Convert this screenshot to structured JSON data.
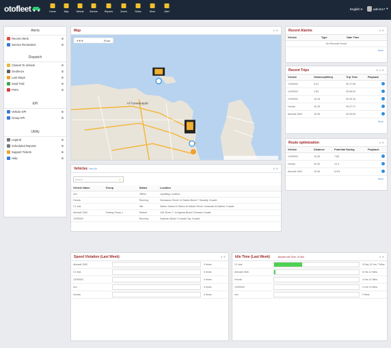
{
  "app": {
    "logo": "otofleet",
    "lang": "English",
    "user": "admin17"
  },
  "nav": [
    {
      "label": "Home",
      "icon": "home-icon"
    },
    {
      "label": "Map",
      "icon": "map-icon"
    },
    {
      "label": "Vehicle",
      "icon": "vehicle-icon"
    },
    {
      "label": "Service",
      "icon": "service-icon"
    },
    {
      "label": "Reports",
      "icon": "reports-icon"
    },
    {
      "label": "Zones",
      "icon": "zones-icon"
    },
    {
      "label": "Rules",
      "icon": "rules-icon"
    },
    {
      "label": "More",
      "icon": "more-icon"
    },
    {
      "label": "Alert",
      "icon": "alert-icon"
    }
  ],
  "sidebar": {
    "alerts": {
      "title": "Alerts",
      "items": [
        {
          "label": "Recent Alerts",
          "color": "#e04a3a"
        },
        {
          "label": "Service Reminders",
          "color": "#3a78d6"
        }
      ]
    },
    "dispatch": {
      "title": "Dispatch",
      "items": [
        {
          "label": "Closest To Vehicle",
          "color": "#e8b73a"
        },
        {
          "label": "Geofence",
          "color": "#5a5a5a"
        },
        {
          "label": "Last Stops",
          "color": "#f0a030"
        },
        {
          "label": "Snail Trail",
          "color": "#3aa84a"
        },
        {
          "label": "POI's",
          "color": "#d83a3a"
        }
      ]
    },
    "kpi": {
      "title": "KPI",
      "items": [
        {
          "label": "Vehicle KPI",
          "color": "#3a78d6"
        },
        {
          "label": "Group KPI",
          "color": "#3a78d6"
        }
      ]
    },
    "utility": {
      "title": "Utility",
      "items": [
        {
          "label": "Legend",
          "color": "#777"
        },
        {
          "label": "Scheduled Reports",
          "color": "#777"
        },
        {
          "label": "Support Tickets",
          "color": "#f0a030"
        },
        {
          "label": "Help",
          "color": "#3a78d6"
        }
      ]
    }
  },
  "map": {
    "title": "Map",
    "place_label": "Al Farwaniyah",
    "type_option": "Road"
  },
  "vehicles": {
    "title": "Vehicles",
    "view_all": "View All",
    "search_placeholder": "Search",
    "columns": [
      "Vehicle Name",
      "Group",
      "Status",
      "Location"
    ],
    "rows": [
      [
        "mvi",
        "",
        "Offline",
        "Updating Location..."
      ],
      [
        "Honda",
        "",
        "Running",
        "Damascus Street, Al Salam-Block 7 Hawally, Kuwait."
      ],
      [
        "C1 test",
        "",
        "Idle",
        "Salem Sabah Al Salem Al Sabah Street, Mubarak Al-Kabeer, Kuwait."
      ],
      [
        "Ahmadi GMC",
        "Testing Group 1",
        "Parked",
        "126 Street 7, Al Ageela-Block7 Ahmadi, Kuwait."
      ],
      [
        "12/90002",
        "",
        "Running",
        "Dasman-Block 1 Kuwait City, Kuwait."
      ]
    ]
  },
  "recent_alarms": {
    "title": "Recent Alarms",
    "columns": [
      "Vehicle",
      "Type",
      "Date Time"
    ],
    "empty": "No Records Found",
    "more": "More"
  },
  "recent_trips": {
    "title": "Recent Trips",
    "columns": [
      "Vehicle",
      "Distance(Miles)",
      "Trip Time",
      "Playback"
    ],
    "rows": [
      [
        "12/90002",
        "6.02",
        "00:17:08"
      ],
      [
        "12/90002",
        "2.80",
        "00:06:00"
      ],
      [
        "12/90002",
        "15.28",
        "00:25:15"
      ],
      [
        "Honda",
        "20.30",
        "00:47:17"
      ],
      [
        "Ahmadi GMC",
        "15.36",
        "00:25:09"
      ]
    ],
    "more": "More"
  },
  "route_opt": {
    "title": "Route optimization",
    "columns": [
      "Vehicle",
      "Distance",
      "Potential Saving",
      "Playback"
    ],
    "rows": [
      [
        "12/90002",
        "15.28",
        "7.86"
      ],
      [
        "Honda",
        "20.30",
        "10.3"
      ],
      [
        "Ahmadi GMC",
        "15.36",
        "8.0%"
      ]
    ],
    "more": "More"
  },
  "speed": {
    "title": "Speed Violation (Last Week)",
    "rows": [
      {
        "label": "Ahmadi GMC",
        "value": "0 times"
      },
      {
        "label": "C1 test",
        "value": "0 times"
      },
      {
        "label": "12/90002",
        "value": "0 times"
      },
      {
        "label": "mvi",
        "value": "0 times"
      },
      {
        "label": "Honda",
        "value": "0 times"
      }
    ]
  },
  "idle": {
    "title": "Idle Time (Last Week)",
    "subtitle": "Allowed Idle Time: 20 Min",
    "rows": [
      {
        "label": "C1 test",
        "value": "5 Day 12 Hrs 7 Mins",
        "fraction": 0.33
      },
      {
        "label": "Ahmadi GMC",
        "value": "8 Hrs 12 Mins",
        "fraction": 0.02
      },
      {
        "label": "Honda",
        "value": "4 Hrs 41 Mins",
        "fraction": 0
      },
      {
        "label": "12/90002",
        "value": "2 Hrs 19 Mins",
        "fraction": 0
      },
      {
        "label": "mvi",
        "value": "0 Mins",
        "fraction": 0
      }
    ]
  }
}
